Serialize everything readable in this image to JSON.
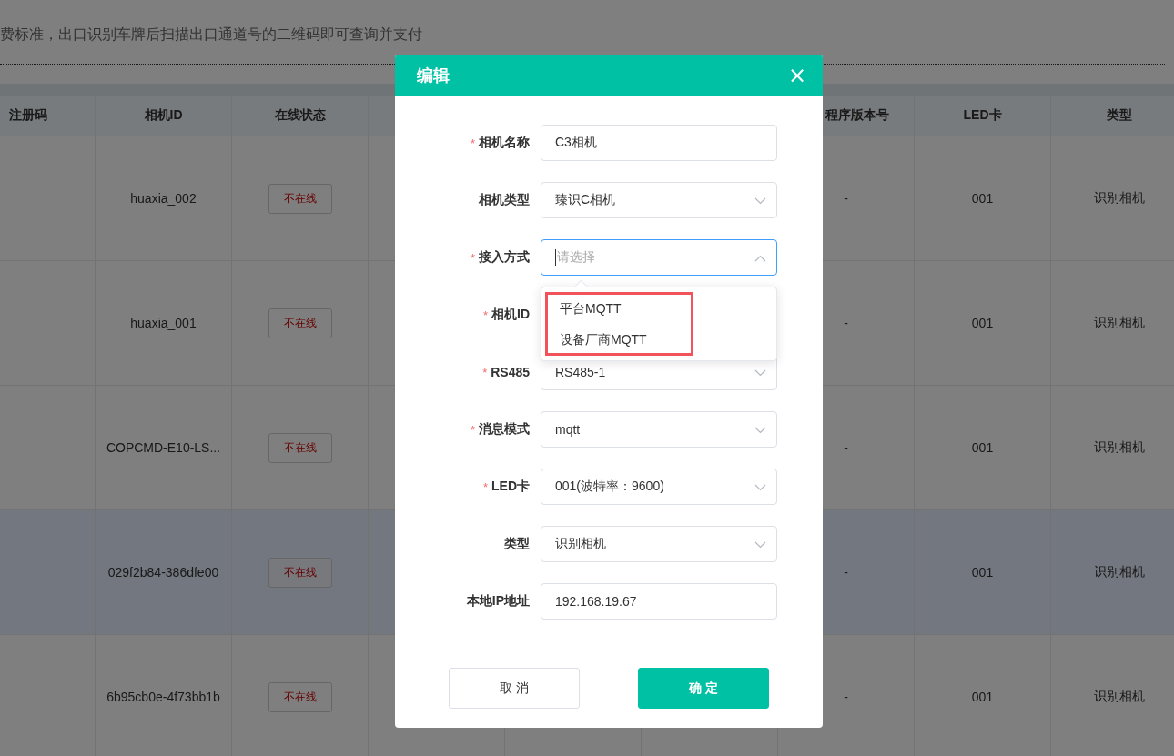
{
  "background": {
    "notice": "费标准，出口识别车牌后扫描出口通道号的二维码即可查询并支付",
    "table": {
      "columns": [
        "注册码",
        "相机ID",
        "在线状态",
        "程序版本号",
        "LED卡",
        "类型"
      ],
      "rows": [
        {
          "camera_id": "huaxia_002",
          "status": "不在线",
          "version": "-",
          "led": "001",
          "type": "识别相机",
          "selected": false
        },
        {
          "camera_id": "huaxia_001",
          "status": "不在线",
          "version": "-",
          "led": "001",
          "type": "识别相机",
          "selected": false
        },
        {
          "camera_id": "COPCMD-E10-LS...",
          "status": "不在线",
          "version": "-",
          "led": "001",
          "type": "识别相机",
          "selected": false
        },
        {
          "camera_id": "029f2b84-386dfe00",
          "status": "不在线",
          "version": "-",
          "led": "001",
          "type": "识别相机",
          "selected": true
        },
        {
          "camera_id": "6b95cb0e-4f73bb1b",
          "status": "不在线",
          "version": "-",
          "led": "001",
          "type": "识别相机",
          "selected": false
        }
      ]
    }
  },
  "dialog": {
    "title": "编辑",
    "close": "×",
    "fields": [
      {
        "required_mark": "*",
        "label": "相机名称",
        "kind": "input",
        "value": "C3相机"
      },
      {
        "label": "相机类型",
        "kind": "select",
        "value": "臻识C相机",
        "open": false
      },
      {
        "required_mark": "*",
        "label": "接入方式",
        "kind": "select",
        "placeholder": "请选择",
        "open": true
      },
      {
        "required_mark": "*",
        "label": "相机ID",
        "kind": "covered"
      },
      {
        "required_mark": "*",
        "label": "RS485",
        "kind": "select",
        "value": "RS485-1",
        "open": false
      },
      {
        "required_mark": "*",
        "label": "消息模式",
        "kind": "select",
        "value": "mqtt",
        "open": false
      },
      {
        "required_mark": "*",
        "label": "LED卡",
        "kind": "select",
        "value": "001(波特率：9600)",
        "open": false
      },
      {
        "label": "类型",
        "kind": "select",
        "value": "识别相机",
        "open": false
      },
      {
        "label": "本地IP地址",
        "kind": "input",
        "value": "192.168.19.67"
      }
    ],
    "dropdown": {
      "options": [
        "平台MQTT",
        "设备厂商MQTT"
      ]
    },
    "buttons": [
      {
        "label": "取 消",
        "kind": "secondary"
      },
      {
        "label": "确 定",
        "kind": "primary"
      }
    ]
  }
}
